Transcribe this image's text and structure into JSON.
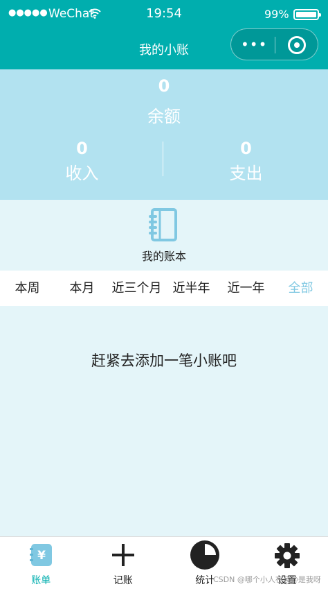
{
  "status": {
    "signal": "●●●●●",
    "carrier": "WeChat",
    "time": "19:54",
    "battery": "99%"
  },
  "header": {
    "title": "我的小账"
  },
  "summary": {
    "balance_value": "0",
    "balance_label": "余额",
    "income_value": "0",
    "income_label": "收入",
    "expense_value": "0",
    "expense_label": "支出"
  },
  "book": {
    "label": "我的账本"
  },
  "filters": [
    {
      "label": "本周"
    },
    {
      "label": "本月"
    },
    {
      "label": "近三个月"
    },
    {
      "label": "近半年"
    },
    {
      "label": "近一年"
    },
    {
      "label": "全部"
    }
  ],
  "active_filter": "全部",
  "empty_message": "赶紧去添加一笔小账吧",
  "tabbar": [
    {
      "label": "账单",
      "icon": "bill-icon"
    },
    {
      "label": "记账",
      "icon": "plus-icon"
    },
    {
      "label": "统计",
      "icon": "pie-chart-icon"
    },
    {
      "label": "设置",
      "icon": "gear-icon"
    }
  ],
  "watermark": "CSDN @哪个小人在装@是我呀",
  "colors": {
    "primary": "#00aeae",
    "summary_bg": "#b2e2f0",
    "page_bg": "#e4f5f9",
    "accent": "#80c8e2"
  }
}
